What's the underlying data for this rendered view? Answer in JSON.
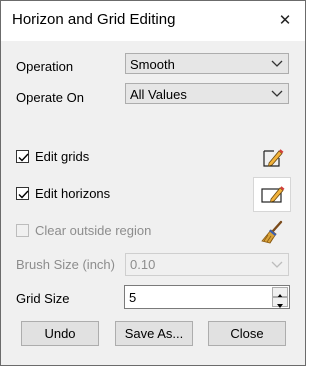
{
  "window": {
    "title": "Horizon and Grid Editing"
  },
  "operation": {
    "label": "Operation",
    "value": "Smooth"
  },
  "operate_on": {
    "label": "Operate On",
    "value": "All Values"
  },
  "edit_grids": {
    "label": "Edit grids",
    "checked": true
  },
  "edit_horizons": {
    "label": "Edit horizons",
    "checked": true
  },
  "clear_outside": {
    "label": "Clear outside region",
    "checked": false,
    "enabled": false
  },
  "brush_size": {
    "label": "Brush Size (inch)",
    "value": "0.10"
  },
  "grid_size": {
    "label": "Grid Size",
    "value": "5"
  },
  "buttons": {
    "undo": "Undo",
    "save_as": "Save As...",
    "close": "Close"
  },
  "icons": {
    "close": "close-icon",
    "edit_grids_tool": "pencil-page-icon",
    "edit_horizons_tool": "pencil-rect-icon",
    "clear_outside_tool": "broom-icon"
  }
}
